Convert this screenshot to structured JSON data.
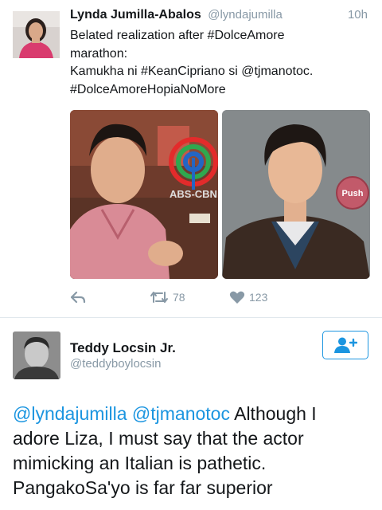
{
  "tweet1": {
    "author_name": "Lynda Jumilla-Abalos",
    "handle": "@lyndajumilla",
    "time": "10h",
    "text_lines": [
      "Belated realization after #DolceAmore",
      "marathon:",
      "Kamukha ni #KeanCipriano si @tjmanotoc.",
      "#DolceAmoreHopiaNoMore"
    ],
    "media_left_logo_text": "ABS-CBN",
    "media_right_badge": "Push",
    "retweets": "78",
    "likes": "123"
  },
  "tweet2": {
    "author_name": "Teddy Locsin Jr.",
    "handle": "@teddyboylocsin",
    "mention1": "@lyndajumilla",
    "mention2": "@tjmanotoc",
    "line1_rest": "Although I",
    "line2": "adore Liza, I must say that the actor",
    "line3": "mimicking an Italian is pathetic.",
    "line4": "PangakoSa'yo is far far superior"
  },
  "colors": {
    "link": "#1b95e0",
    "secondary_text": "#8899a6",
    "divider": "#e1e8ed"
  },
  "icons": [
    "reply-icon",
    "retweet-icon",
    "heart-icon",
    "follow-user-icon"
  ]
}
